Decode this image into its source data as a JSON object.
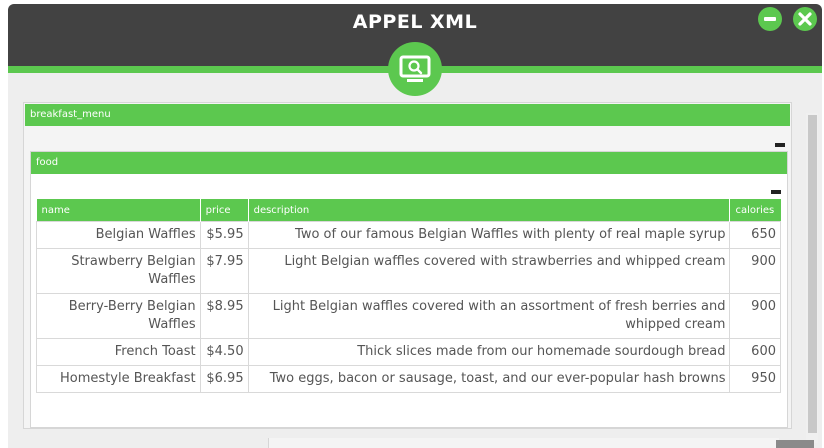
{
  "window": {
    "title": "APPEL XML",
    "minimize_icon": "minus-icon",
    "close_icon": "close-icon",
    "badge_icon": "monitor-search-icon"
  },
  "colors": {
    "accent": "#5cc84f",
    "titlebar": "#424242",
    "text": "#555555"
  },
  "outer_panel": {
    "header": "breakfast_menu"
  },
  "inner_panel": {
    "header": "food",
    "columns": [
      "name",
      "price",
      "description",
      "calories"
    ],
    "rows": [
      {
        "name": "Belgian Waffles",
        "price": "$5.95",
        "description": "Two of our famous Belgian Waffles with plenty of real maple syrup",
        "calories": "650"
      },
      {
        "name": "Strawberry Belgian Waffles",
        "price": "$7.95",
        "description": "Light Belgian waffles covered with strawberries and whipped cream",
        "calories": "900"
      },
      {
        "name": "Berry-Berry Belgian Waffles",
        "price": "$8.95",
        "description": "Light Belgian waffles covered with an assortment of fresh berries and whipped cream",
        "calories": "900"
      },
      {
        "name": "French Toast",
        "price": "$4.50",
        "description": "Thick slices made from our homemade sourdough bread",
        "calories": "600"
      },
      {
        "name": "Homestyle Breakfast",
        "price": "$6.95",
        "description": "Two eggs, bacon or sausage, toast, and our ever-popular hash browns",
        "calories": "950"
      }
    ]
  }
}
